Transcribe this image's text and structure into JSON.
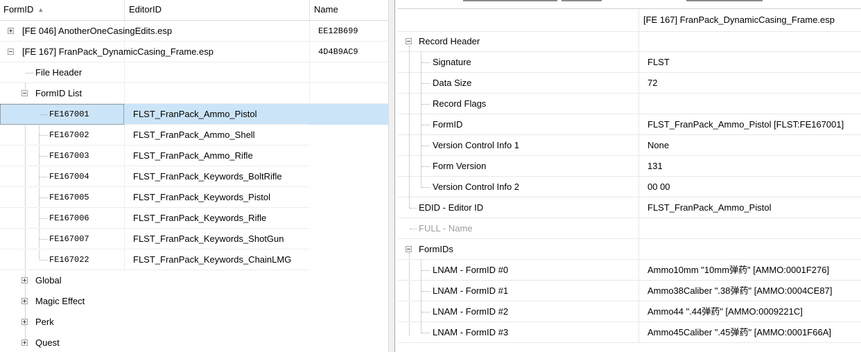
{
  "left": {
    "headers": {
      "formid": "FormID",
      "editorid": "EditorID",
      "name": "Name"
    },
    "plugins": [
      {
        "label": "[FE 046] AnotherOneCasingEdits.esp",
        "name": "EE12B699"
      },
      {
        "label": "[FE 167] FranPack_DynamicCasing_Frame.esp",
        "name": "4D4B9AC9"
      }
    ],
    "groups": {
      "file_header": "File Header",
      "formid_list": "FormID List"
    },
    "records": [
      {
        "formid": "FE167001",
        "editorid": "FLST_FranPack_Ammo_Pistol"
      },
      {
        "formid": "FE167002",
        "editorid": "FLST_FranPack_Ammo_Shell"
      },
      {
        "formid": "FE167003",
        "editorid": "FLST_FranPack_Ammo_Rifle"
      },
      {
        "formid": "FE167004",
        "editorid": "FLST_FranPack_Keywords_BoltRifle"
      },
      {
        "formid": "FE167005",
        "editorid": "FLST_FranPack_Keywords_Pistol"
      },
      {
        "formid": "FE167006",
        "editorid": "FLST_FranPack_Keywords_Rifle"
      },
      {
        "formid": "FE167007",
        "editorid": "FLST_FranPack_Keywords_ShotGun"
      },
      {
        "formid": "FE167022",
        "editorid": "FLST_FranPack_Keywords_ChainLMG"
      }
    ],
    "more_groups": [
      "Global",
      "Magic Effect",
      "Perk",
      "Quest"
    ]
  },
  "right": {
    "file_title": "[FE 167] FranPack_DynamicCasing_Frame.esp",
    "record_header": "Record Header",
    "header_fields": [
      {
        "label": "Signature",
        "value": "FLST"
      },
      {
        "label": "Data Size",
        "value": "72"
      },
      {
        "label": "Record Flags",
        "value": ""
      },
      {
        "label": "FormID",
        "value": "FLST_FranPack_Ammo_Pistol [FLST:FE167001]"
      },
      {
        "label": "Version Control Info 1",
        "value": "None"
      },
      {
        "label": "Form Version",
        "value": "131"
      },
      {
        "label": "Version Control Info 2",
        "value": "00 00"
      }
    ],
    "edid": {
      "label": "EDID - Editor ID",
      "value": "FLST_FranPack_Ammo_Pistol"
    },
    "full": {
      "label": "FULL - Name",
      "value": ""
    },
    "formids_group": "FormIDs",
    "formids": [
      {
        "label": "LNAM - FormID #0",
        "value": "Ammo10mm \"10mm弹药\" [AMMO:0001F276]"
      },
      {
        "label": "LNAM - FormID #1",
        "value": "Ammo38Caliber \".38弹药\" [AMMO:0004CE87]"
      },
      {
        "label": "LNAM - FormID #2",
        "value": "Ammo44 \".44弹药\" [AMMO:0009221C]"
      },
      {
        "label": "LNAM - FormID #3",
        "value": "Ammo45Caliber \".45弹药\" [AMMO:0001F66A]"
      }
    ]
  },
  "colors": {
    "selection": "#cce4f7",
    "dim_label": "#9c9c9c"
  }
}
